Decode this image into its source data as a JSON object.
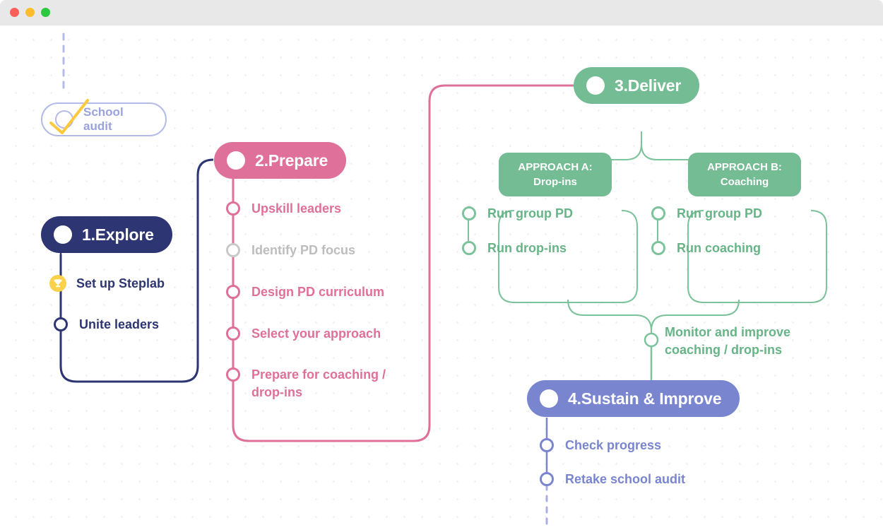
{
  "window": {
    "traffic_lights": [
      "close",
      "minimize",
      "zoom"
    ],
    "colors": {
      "titlebar": "#e8e8e8",
      "close": "#fb6058",
      "minimize": "#fcbc2e",
      "zoom": "#2bc840"
    }
  },
  "theme": {
    "navy": "#2d3672",
    "pink": "#de7099",
    "green": "#74bc93",
    "green_line": "#7cc29b",
    "purple": "#7986cf",
    "yellow": "#fbd14b",
    "grey_disabled": "#bdbdbd",
    "audit_outline": "#b5bbe8",
    "audit_text": "#9aa2dd"
  },
  "audit": {
    "label": "School audit",
    "icon": "check-circle-icon",
    "state": "completed"
  },
  "stages": [
    {
      "id": "explore",
      "title": "1.Explore",
      "color": "#2d3672",
      "tasks": [
        {
          "label": "Set up Steplab",
          "icon": "trophy-icon",
          "state": "achievement"
        },
        {
          "label": "Unite leaders",
          "icon": "circle-icon",
          "state": "todo"
        }
      ]
    },
    {
      "id": "prepare",
      "title": "2.Prepare",
      "color": "#de7099",
      "tasks": [
        {
          "label": "Upskill leaders",
          "icon": "circle-icon",
          "state": "todo"
        },
        {
          "label": "Identify PD focus",
          "icon": "circle-icon",
          "state": "disabled"
        },
        {
          "label": "Design PD curriculum",
          "icon": "circle-icon",
          "state": "todo"
        },
        {
          "label": "Select your approach",
          "icon": "circle-icon",
          "state": "todo"
        },
        {
          "label": "Prepare for coaching /\ndrop-ins",
          "icon": "circle-icon",
          "state": "todo"
        }
      ]
    },
    {
      "id": "deliver",
      "title": "3.Deliver",
      "color": "#74bc93",
      "approaches": [
        {
          "tag": "APPROACH A:\nDrop-ins",
          "tasks": [
            {
              "label": "Run group PD",
              "icon": "circle-icon",
              "state": "todo"
            },
            {
              "label": "Run drop-ins",
              "icon": "circle-icon",
              "state": "todo"
            }
          ]
        },
        {
          "tag": "APPROACH B:\nCoaching",
          "tasks": [
            {
              "label": "Run group PD",
              "icon": "circle-icon",
              "state": "todo"
            },
            {
              "label": "Run coaching",
              "icon": "circle-icon",
              "state": "todo"
            }
          ]
        }
      ],
      "merge_caption": "Monitor and improve\ncoaching / drop-ins"
    },
    {
      "id": "sustain",
      "title": "4.Sustain & Improve",
      "color": "#7986cf",
      "tasks": [
        {
          "label": "Check progress",
          "icon": "circle-icon",
          "state": "todo"
        },
        {
          "label": "Retake school audit",
          "icon": "circle-icon",
          "state": "todo"
        }
      ]
    }
  ]
}
